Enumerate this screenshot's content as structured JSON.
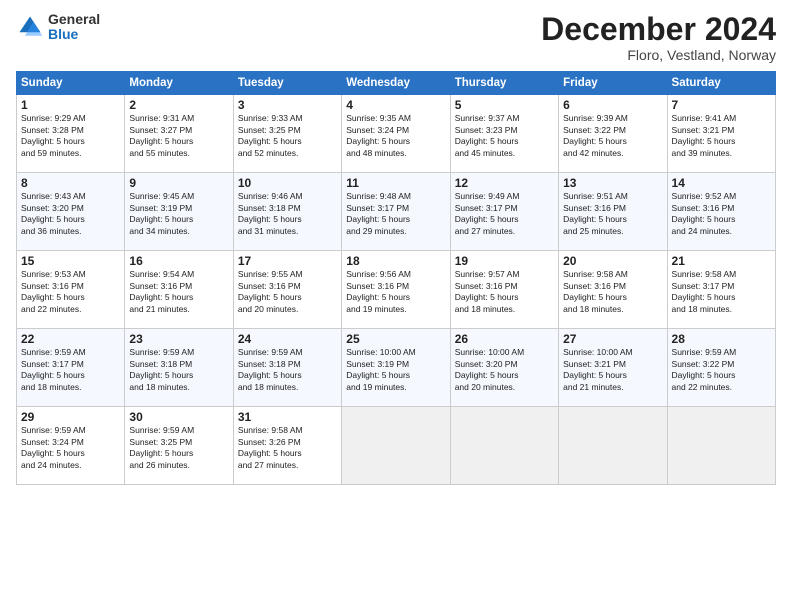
{
  "header": {
    "logo_general": "General",
    "logo_blue": "Blue",
    "month": "December 2024",
    "location": "Floro, Vestland, Norway"
  },
  "columns": [
    "Sunday",
    "Monday",
    "Tuesday",
    "Wednesday",
    "Thursday",
    "Friday",
    "Saturday"
  ],
  "weeks": [
    [
      {
        "day": "1",
        "lines": [
          "Sunrise: 9:29 AM",
          "Sunset: 3:28 PM",
          "Daylight: 5 hours",
          "and 59 minutes."
        ]
      },
      {
        "day": "2",
        "lines": [
          "Sunrise: 9:31 AM",
          "Sunset: 3:27 PM",
          "Daylight: 5 hours",
          "and 55 minutes."
        ]
      },
      {
        "day": "3",
        "lines": [
          "Sunrise: 9:33 AM",
          "Sunset: 3:25 PM",
          "Daylight: 5 hours",
          "and 52 minutes."
        ]
      },
      {
        "day": "4",
        "lines": [
          "Sunrise: 9:35 AM",
          "Sunset: 3:24 PM",
          "Daylight: 5 hours",
          "and 48 minutes."
        ]
      },
      {
        "day": "5",
        "lines": [
          "Sunrise: 9:37 AM",
          "Sunset: 3:23 PM",
          "Daylight: 5 hours",
          "and 45 minutes."
        ]
      },
      {
        "day": "6",
        "lines": [
          "Sunrise: 9:39 AM",
          "Sunset: 3:22 PM",
          "Daylight: 5 hours",
          "and 42 minutes."
        ]
      },
      {
        "day": "7",
        "lines": [
          "Sunrise: 9:41 AM",
          "Sunset: 3:21 PM",
          "Daylight: 5 hours",
          "and 39 minutes."
        ]
      }
    ],
    [
      {
        "day": "8",
        "lines": [
          "Sunrise: 9:43 AM",
          "Sunset: 3:20 PM",
          "Daylight: 5 hours",
          "and 36 minutes."
        ]
      },
      {
        "day": "9",
        "lines": [
          "Sunrise: 9:45 AM",
          "Sunset: 3:19 PM",
          "Daylight: 5 hours",
          "and 34 minutes."
        ]
      },
      {
        "day": "10",
        "lines": [
          "Sunrise: 9:46 AM",
          "Sunset: 3:18 PM",
          "Daylight: 5 hours",
          "and 31 minutes."
        ]
      },
      {
        "day": "11",
        "lines": [
          "Sunrise: 9:48 AM",
          "Sunset: 3:17 PM",
          "Daylight: 5 hours",
          "and 29 minutes."
        ]
      },
      {
        "day": "12",
        "lines": [
          "Sunrise: 9:49 AM",
          "Sunset: 3:17 PM",
          "Daylight: 5 hours",
          "and 27 minutes."
        ]
      },
      {
        "day": "13",
        "lines": [
          "Sunrise: 9:51 AM",
          "Sunset: 3:16 PM",
          "Daylight: 5 hours",
          "and 25 minutes."
        ]
      },
      {
        "day": "14",
        "lines": [
          "Sunrise: 9:52 AM",
          "Sunset: 3:16 PM",
          "Daylight: 5 hours",
          "and 24 minutes."
        ]
      }
    ],
    [
      {
        "day": "15",
        "lines": [
          "Sunrise: 9:53 AM",
          "Sunset: 3:16 PM",
          "Daylight: 5 hours",
          "and 22 minutes."
        ]
      },
      {
        "day": "16",
        "lines": [
          "Sunrise: 9:54 AM",
          "Sunset: 3:16 PM",
          "Daylight: 5 hours",
          "and 21 minutes."
        ]
      },
      {
        "day": "17",
        "lines": [
          "Sunrise: 9:55 AM",
          "Sunset: 3:16 PM",
          "Daylight: 5 hours",
          "and 20 minutes."
        ]
      },
      {
        "day": "18",
        "lines": [
          "Sunrise: 9:56 AM",
          "Sunset: 3:16 PM",
          "Daylight: 5 hours",
          "and 19 minutes."
        ]
      },
      {
        "day": "19",
        "lines": [
          "Sunrise: 9:57 AM",
          "Sunset: 3:16 PM",
          "Daylight: 5 hours",
          "and 18 minutes."
        ]
      },
      {
        "day": "20",
        "lines": [
          "Sunrise: 9:58 AM",
          "Sunset: 3:16 PM",
          "Daylight: 5 hours",
          "and 18 minutes."
        ]
      },
      {
        "day": "21",
        "lines": [
          "Sunrise: 9:58 AM",
          "Sunset: 3:17 PM",
          "Daylight: 5 hours",
          "and 18 minutes."
        ]
      }
    ],
    [
      {
        "day": "22",
        "lines": [
          "Sunrise: 9:59 AM",
          "Sunset: 3:17 PM",
          "Daylight: 5 hours",
          "and 18 minutes."
        ]
      },
      {
        "day": "23",
        "lines": [
          "Sunrise: 9:59 AM",
          "Sunset: 3:18 PM",
          "Daylight: 5 hours",
          "and 18 minutes."
        ]
      },
      {
        "day": "24",
        "lines": [
          "Sunrise: 9:59 AM",
          "Sunset: 3:18 PM",
          "Daylight: 5 hours",
          "and 18 minutes."
        ]
      },
      {
        "day": "25",
        "lines": [
          "Sunrise: 10:00 AM",
          "Sunset: 3:19 PM",
          "Daylight: 5 hours",
          "and 19 minutes."
        ]
      },
      {
        "day": "26",
        "lines": [
          "Sunrise: 10:00 AM",
          "Sunset: 3:20 PM",
          "Daylight: 5 hours",
          "and 20 minutes."
        ]
      },
      {
        "day": "27",
        "lines": [
          "Sunrise: 10:00 AM",
          "Sunset: 3:21 PM",
          "Daylight: 5 hours",
          "and 21 minutes."
        ]
      },
      {
        "day": "28",
        "lines": [
          "Sunrise: 9:59 AM",
          "Sunset: 3:22 PM",
          "Daylight: 5 hours",
          "and 22 minutes."
        ]
      }
    ],
    [
      {
        "day": "29",
        "lines": [
          "Sunrise: 9:59 AM",
          "Sunset: 3:24 PM",
          "Daylight: 5 hours",
          "and 24 minutes."
        ]
      },
      {
        "day": "30",
        "lines": [
          "Sunrise: 9:59 AM",
          "Sunset: 3:25 PM",
          "Daylight: 5 hours",
          "and 26 minutes."
        ]
      },
      {
        "day": "31",
        "lines": [
          "Sunrise: 9:58 AM",
          "Sunset: 3:26 PM",
          "Daylight: 5 hours",
          "and 27 minutes."
        ]
      },
      null,
      null,
      null,
      null
    ]
  ]
}
